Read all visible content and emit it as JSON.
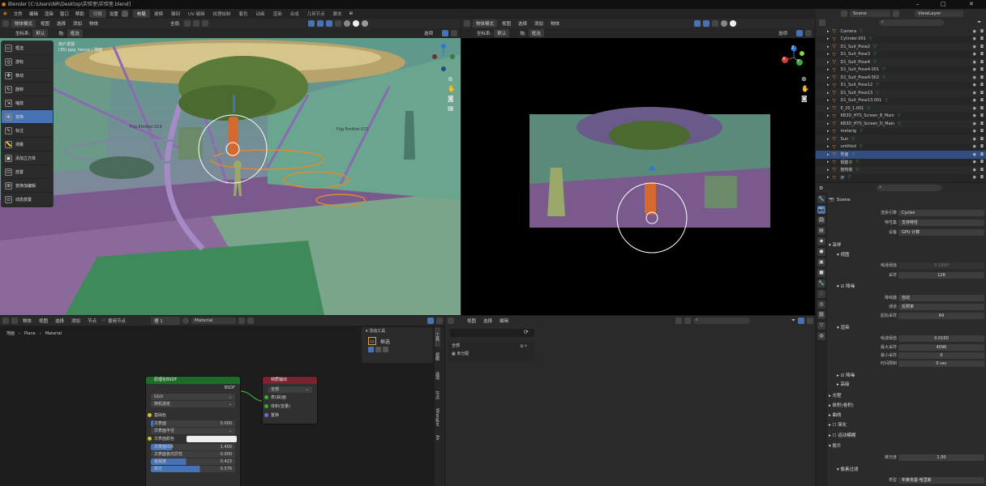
{
  "title": "Blender [C:\\Users\\NR\\Desktop\\实验室\\实验室.blend]",
  "window_controls": [
    "–",
    "□",
    "✕"
  ],
  "menu": [
    "文件",
    "编辑",
    "渲染",
    "窗口",
    "帮助"
  ],
  "switch_label": "切换",
  "settings_label": "设置",
  "workspaces": [
    "布局",
    "建模",
    "雕刻",
    "UV 编辑",
    "纹理绘制",
    "着色",
    "动画",
    "渲染",
    "合成",
    "几何节点",
    "脚本"
  ],
  "vp1": {
    "mode": "物体模式",
    "menus": [
      "视图",
      "选择",
      "添加",
      "物体"
    ],
    "orient": "全局",
    "coord_label": "坐标系:",
    "coord_val": "默认",
    "drag_label": "拖:",
    "drag_val": "框选",
    "options": "选项",
    "overlay_line1": "用户透视",
    "overlay_line2": "(35) ppp_hence | 地面",
    "label_a": "Fog Emitter.019",
    "label_b": "Fog Emitter.025"
  },
  "tools": [
    "框选",
    "游标",
    "移动",
    "旋转",
    "缩放",
    "变换",
    "标注",
    "测量",
    "添加立方体",
    "放置",
    "变换加编辑",
    "动态放置"
  ],
  "tools_active": 5,
  "vp2": {
    "mode": "物体模式",
    "menus": [
      "视图",
      "选择",
      "添加",
      "物体"
    ],
    "coord_label": "坐标系:",
    "coord_val": "默认",
    "drag_label": "拖:",
    "drag_val": "框选",
    "options": "选项"
  },
  "gizmo": {
    "x": "X",
    "y": "Y",
    "z": "Z"
  },
  "outliner": {
    "scene": "Scene",
    "view_layer": "ViewLayer",
    "items": [
      "Camera",
      "Cylinder.001",
      "D1_Suit_Pose2",
      "D1_Suit_Pose3",
      "D1_Suit_Pose4",
      "D1_Suit_Pose4.001",
      "D1_Suit_Pose4.002",
      "D1_Suit_Pose12",
      "D1_Suit_Pose13",
      "D1_Suit_Pose13.001",
      "E_20_1.001",
      "KB3D_HTS_Screen_B_Main",
      "KB3D_HTS_Screen_D_Main",
      "metarig",
      "Sun",
      "untitled",
      "地面",
      "钢筋子",
      "植物底",
      "坏"
    ],
    "selected": 16
  },
  "props": {
    "scene_name": "Scene",
    "render_engine_label": "渲染引擎",
    "render_engine": "Cycles",
    "feature_set_label": "特性集",
    "feature_set": "支持特性",
    "device_label": "设备",
    "device": "GPU 计算",
    "sampling": "采样",
    "viewport": "视图",
    "noise_threshold_label": "噪波阈值",
    "noise_threshold_vp": "0.1000",
    "samples_label": "采样",
    "samples_vp": "128",
    "denoise": "降噪",
    "denoiser_label": "降噪器",
    "denoiser": "自动",
    "passes_label": "通道",
    "passes": "反照率",
    "start_sample_label": "起始采样",
    "start_sample": "64",
    "render": "渲染",
    "noise_threshold_r": "0.0100",
    "max_samples_label": "最大采样",
    "max_samples": "4096",
    "min_samples_label": "最小采样",
    "min_samples": "0",
    "time_limit_label": "时间限制",
    "time_limit": "0 sec",
    "denoise2": "降噪",
    "advanced": "高级",
    "light_paths": "光程",
    "volumes": "体积(卷积)",
    "curves": "曲线",
    "simplify": "简化",
    "motion_blur": "运动模糊",
    "film": "胶片",
    "exposure_label": "曝光度",
    "exposure": "1.00",
    "pixel_filter": "像素过滤",
    "type_label": "类型",
    "type": "布莱克曼-哈里斯"
  },
  "node_editor": {
    "object": "物体",
    "menus": [
      "视图",
      "选择",
      "添加",
      "节点"
    ],
    "use_nodes": "使用节点",
    "slot": "槽 1",
    "material": "Material",
    "breadcrumb": [
      "地面",
      "Plane",
      "Material"
    ],
    "bsdf": {
      "title": "原理化BSDF",
      "out": "BSDF",
      "dist": "GGX",
      "sss": "随机游走",
      "fields": [
        {
          "k": "基础色",
          "v": ""
        },
        {
          "k": "次表面",
          "v": "0.000"
        },
        {
          "k": "次表面半径",
          "v": ""
        },
        {
          "k": "次表面颜色",
          "v": ""
        },
        {
          "k": "次表面IOR",
          "v": "1.400"
        },
        {
          "k": "次表面各向异性",
          "v": "0.000"
        },
        {
          "k": "金属度",
          "v": "0.423"
        },
        {
          "k": "高光",
          "v": "0.576"
        }
      ]
    },
    "output": {
      "title": "材质输出",
      "target": "全部",
      "sockets": [
        "表(曲)面",
        "体积(音量)",
        "置换"
      ]
    }
  },
  "tool_panel": {
    "title": "活动工具",
    "tool": "框选",
    "tabs": [
      "工具",
      "视图",
      "选项",
      "节点",
      "Wrangler",
      "Ah"
    ]
  },
  "image_editor": {
    "menus": [
      "视图",
      "选择",
      "编辑"
    ],
    "all_label": "全部",
    "unassigned": "未分配"
  },
  "colors": {
    "accent": "#4772b3",
    "selected": "#334d80",
    "bsdf_header": "#1f6b2a",
    "output_header": "#7a2330"
  }
}
